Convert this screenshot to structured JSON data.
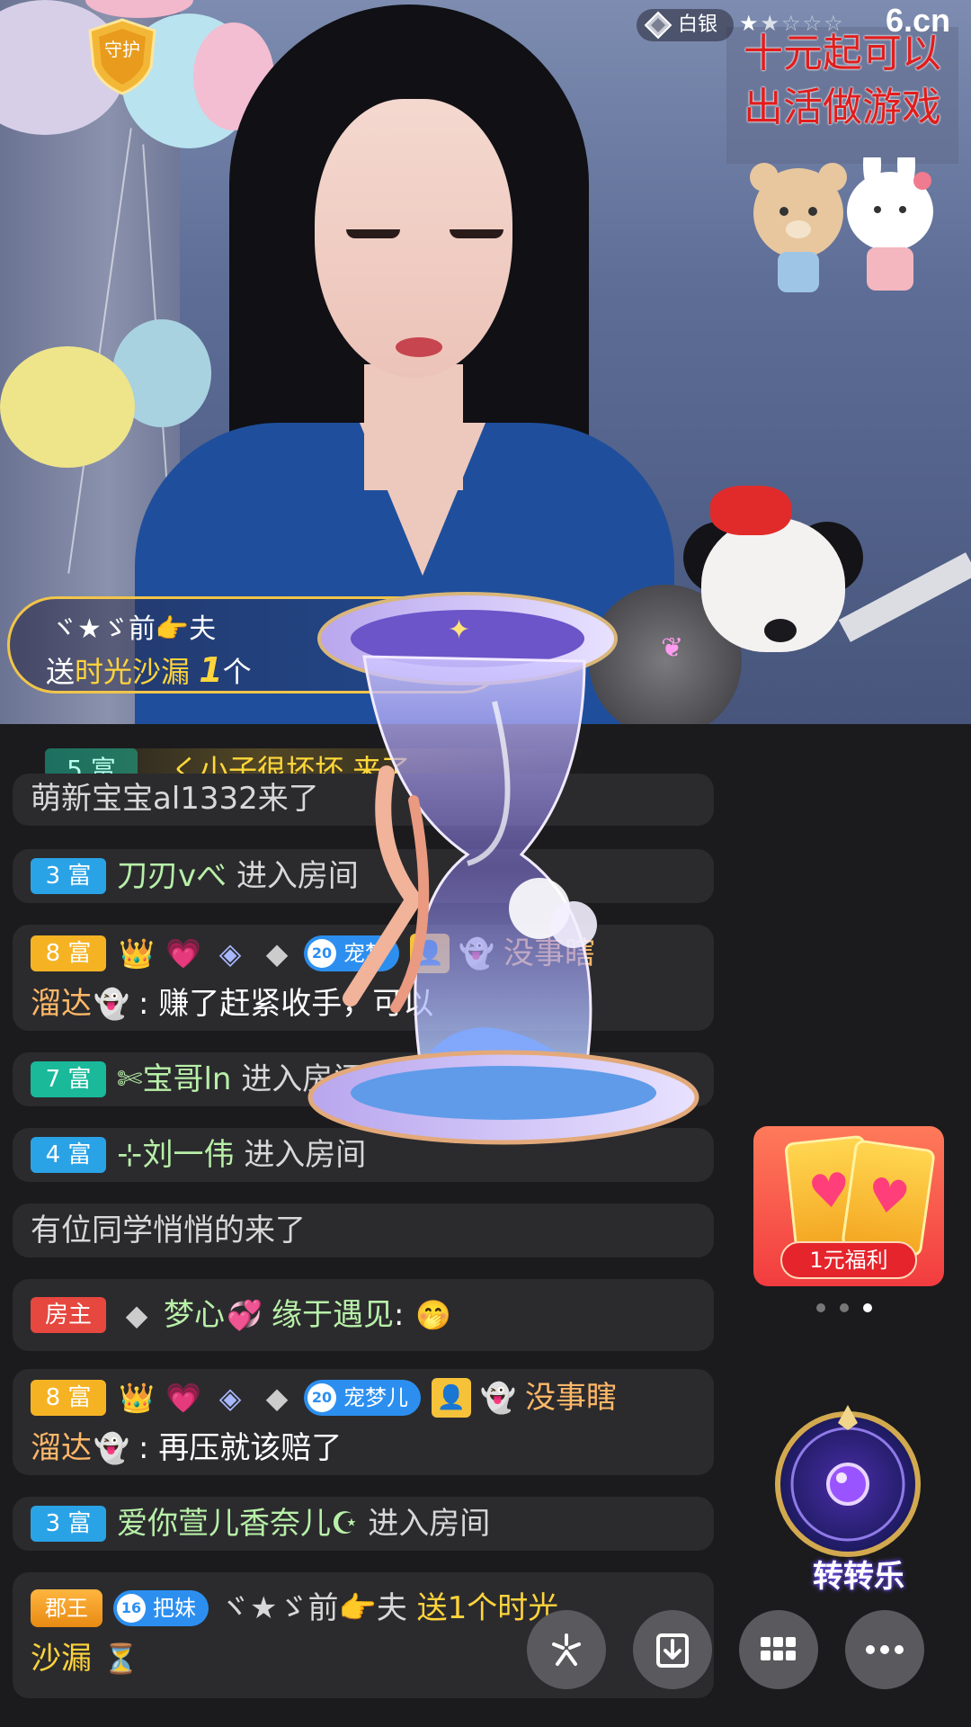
{
  "stream": {
    "guard_badge_label": "守护",
    "rank": {
      "name": "白银",
      "stars_filled": 1.5,
      "stars_total": 5
    },
    "logo": "6.cn",
    "promo_lines": [
      "十元起可以",
      "出活做游戏"
    ]
  },
  "gift_toast": {
    "sender": "ヾ★ゞ前👉夫",
    "prefix": "送",
    "gift": "时光沙漏",
    "count": "1",
    "unit": "个"
  },
  "enter_banner": {
    "level": "5 富",
    "text": "く小子很坏坏 来了"
  },
  "chat": [
    {
      "id": "welcome-1",
      "text": "萌新宝宝al1332来了"
    },
    {
      "id": "enter-2",
      "level": "3 富",
      "name": "刀刃vべ",
      "action": "进入房间"
    },
    {
      "id": "msg-3",
      "level": "8 富",
      "fan_num": "20",
      "fan_name": "宠梦",
      "name_a": "没事瞎",
      "name_b": "溜达",
      "text": ": 赚了赶紧收手，可以"
    },
    {
      "id": "enter-4",
      "level": "7 富",
      "name": "✄宝哥ln",
      "action": "进入房间"
    },
    {
      "id": "enter-5",
      "level": "4 富",
      "name": "⊹刘一伟",
      "action": "进入房间"
    },
    {
      "id": "quiet-6",
      "text": "有位同学悄悄的来了"
    },
    {
      "id": "host-7",
      "level": "房主",
      "name_a": "梦心",
      "name_b": "缘于遇见",
      "text": ":"
    },
    {
      "id": "msg-8",
      "level": "8 富",
      "fan_num": "20",
      "fan_name": "宠梦儿",
      "name_a": "没事瞎",
      "name_b": "溜达",
      "text": ": 再压就该赔了"
    },
    {
      "id": "enter-9",
      "level": "3 富",
      "name": "爱你萱儿香奈儿☪",
      "action": "进入房间"
    },
    {
      "id": "gift-10",
      "title": "郡王",
      "fan_num": "16",
      "fan_name": "把妹",
      "name": "ヾ★ゞ前👉夫",
      "text_a": "送1个时光",
      "text_b": "沙漏"
    }
  ],
  "welfare": {
    "label": "1元福利",
    "page_count": 3,
    "active_page": 3
  },
  "lucky_wheel": {
    "label": "转转乐"
  },
  "toolbar": [
    "share-icon",
    "download-icon",
    "grid-menu-icon",
    "more-icon"
  ]
}
